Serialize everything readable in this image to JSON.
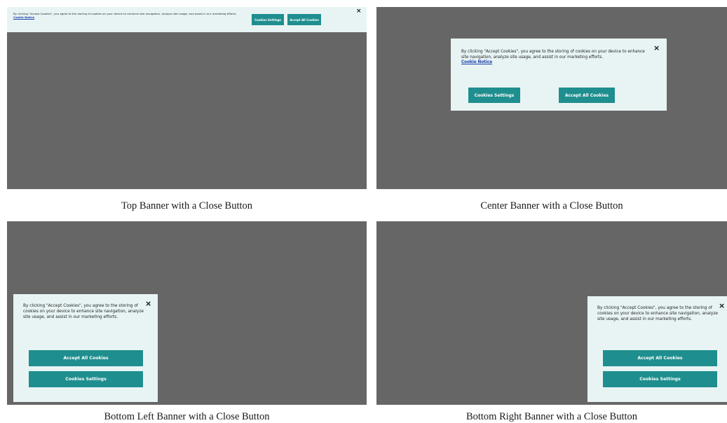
{
  "colors": {
    "screen_background": "#666666",
    "banner_background": "#e8f4f4",
    "button_background": "#1f8e8e",
    "button_text": "#ffffff",
    "link": "#1a3fa8"
  },
  "icons": {
    "close": "close-icon"
  },
  "panels": [
    {
      "caption": "Top Banner with a Close Button",
      "message": "By clicking \"Accept Cookies\", you agree to the storing of cookies on your device to enhance site navigation, analyze site usage, and assist in our marketing efforts.",
      "link_text": "Cookie Notice",
      "close_glyph": "×",
      "button1": "Cookies Settings",
      "button2": "Accept All Cookies"
    },
    {
      "caption": "Center Banner with a Close Button",
      "message": "By clicking \"Accept Cookies\", you agree to the storing of cookies on your device to enhance site navigation, analyze site usage, and assist in our marketing efforts.",
      "link_text": "Cookie Notice",
      "close_glyph": "×",
      "button1": "Cookies Settings",
      "button2": "Accept All Cookies"
    },
    {
      "caption": "Bottom Left Banner with a Close Button",
      "message": "By clicking \"Accept Cookies\", you agree to the storing of cookies on your device to enhance site navigation, analyze site usage, and assist in our marketing efforts.",
      "close_glyph": "×",
      "button1": "Accept All Cookies",
      "button2": "Cookies Settings"
    },
    {
      "caption": "Bottom Right Banner with a Close Button",
      "message": "By clicking \"Accept Cookies\", you agree to the storing of cookies on your device to enhance site navigation, analyze site usage, and assist in our marketing efforts.",
      "close_glyph": "×",
      "button1": "Accept All Cookies",
      "button2": "Cookies Settings"
    }
  ]
}
